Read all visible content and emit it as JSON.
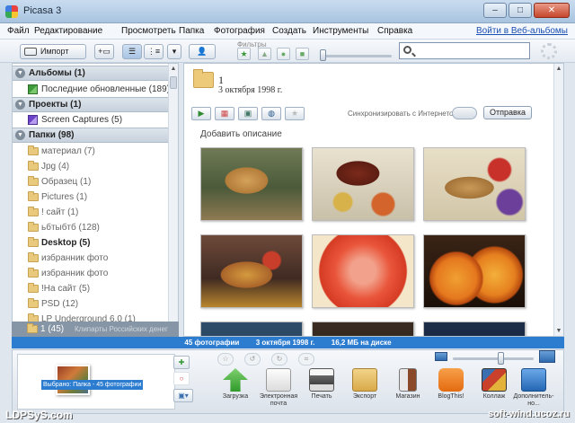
{
  "window": {
    "title": "Picasa 3",
    "minimize": "–",
    "maximize": "□",
    "close": "✕"
  },
  "menu": {
    "items": [
      "Файл",
      "Редактирование",
      "Просмотреть",
      "Папка",
      "Фотография",
      "Создать",
      "Инструменты",
      "Справка"
    ],
    "web_link": "Войти в Веб-альбомы"
  },
  "toolbar": {
    "import_label": "Импорт",
    "filters_label": "Фильтры",
    "search_placeholder": ""
  },
  "sidebar": {
    "albums": {
      "label": "Альбомы (1)",
      "toggle": "▼"
    },
    "album_items": [
      {
        "label": "Последние обновленные (189)"
      }
    ],
    "projects": {
      "label": "Проекты (1)",
      "toggle": "▼"
    },
    "project_items": [
      {
        "label": "Screen Captures (5)"
      }
    ],
    "folders": {
      "label": "Папки (98)",
      "toggle": "▼"
    },
    "folder_items": [
      {
        "label": "материал (7)"
      },
      {
        "label": "Jpg (4)"
      },
      {
        "label": "Образец (1)"
      },
      {
        "label": "Pictures (1)"
      },
      {
        "label": "! сайт (1)"
      },
      {
        "label": "ьбтыбтб (128)"
      },
      {
        "label": "Desktop (5)"
      },
      {
        "label": "избранник фото"
      },
      {
        "label": "избранник фото"
      },
      {
        "label": "!На сайт (5)"
      },
      {
        "label": "PSD (12)"
      },
      {
        "label": "LP Underground 6.0 (1)"
      }
    ],
    "selected": {
      "label": "1 (45)"
    },
    "overlap_text": "Клипарты Российских денег"
  },
  "main": {
    "album_title": "1",
    "album_date": "3 октября 1998 г.",
    "sync_label": "Синхронизировать с Интернетом",
    "share_label": "Отправка",
    "description_placeholder": "Добавить описание"
  },
  "status": {
    "count": "45 фотографии",
    "date": "3 октября 1998 г.",
    "size": "16,2 МБ на диске"
  },
  "tray": {
    "selection_label": "Выбрано: Папка - 45 фотографии",
    "tools": [
      {
        "label": "Загрузка",
        "icon": "upload-icon"
      },
      {
        "label": "Электронная почта",
        "icon": "email-icon"
      },
      {
        "label": "Печать",
        "icon": "print-icon"
      },
      {
        "label": "Экспорт",
        "icon": "export-icon"
      },
      {
        "label": "Магазин",
        "icon": "shop-icon"
      },
      {
        "label": "BlogThis!",
        "icon": "blogger-icon"
      },
      {
        "label": "Коллаж",
        "icon": "collage-icon"
      },
      {
        "label": "Дополнитель-но...",
        "icon": "more-icon"
      }
    ]
  },
  "watermark": {
    "left": "LDPSyS.com",
    "right": "soft-wind.ucoz.ru"
  },
  "colors": {
    "status_bar": "#2c7cd0",
    "accent": "#1a4fb3"
  }
}
